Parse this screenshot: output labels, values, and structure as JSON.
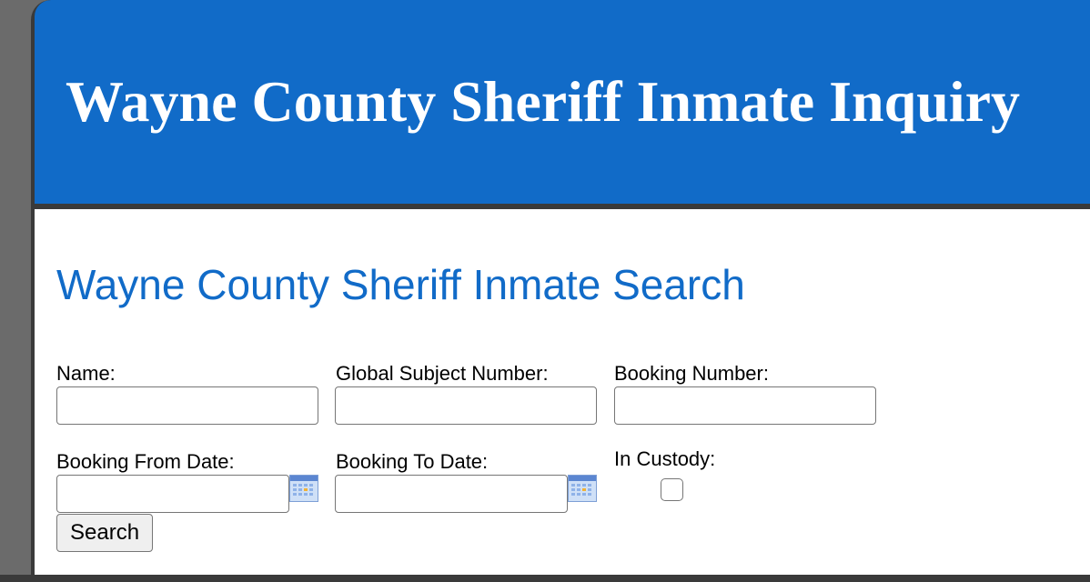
{
  "header": {
    "title": "Wayne County Sheriff Inmate Inquiry"
  },
  "main": {
    "title": "Wayne County Sheriff Inmate Search",
    "fields": {
      "name": {
        "label": "Name:",
        "value": ""
      },
      "global_subject_number": {
        "label": "Global Subject Number:",
        "value": ""
      },
      "booking_number": {
        "label": "Booking Number:",
        "value": ""
      },
      "booking_from_date": {
        "label": "Booking From Date:",
        "value": ""
      },
      "booking_to_date": {
        "label": "Booking To Date:",
        "value": ""
      },
      "in_custody": {
        "label": "In Custody:",
        "checked": false
      }
    },
    "search_button_label": "Search"
  },
  "icons": {
    "calendar": "calendar-icon"
  },
  "colors": {
    "brand_blue": "#116bc8",
    "frame_dark": "#3a3a3a",
    "background": "#ffffff"
  }
}
